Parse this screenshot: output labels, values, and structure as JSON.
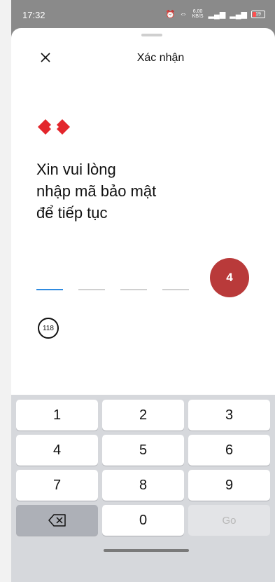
{
  "status_bar": {
    "time": "17:32",
    "net_speed": "6,00 KB/S",
    "battery": "19"
  },
  "header": {
    "title": "Xác nhận"
  },
  "prompt": [
    "Xin vui lòng",
    "nhập mã bảo mật",
    "để tiếp tục"
  ],
  "step_badge": "4",
  "timer": "118",
  "keypad": {
    "keys": [
      "1",
      "2",
      "3",
      "4",
      "5",
      "6",
      "7",
      "8",
      "9",
      "0"
    ],
    "go_label": "Go"
  },
  "colors": {
    "accent": "#2f8be0",
    "badge": "#b93a3a",
    "logo": "#e3262c"
  },
  "icons": {
    "close": "close-icon",
    "backspace": "backspace-icon",
    "logo": "bank-logo-icon"
  }
}
